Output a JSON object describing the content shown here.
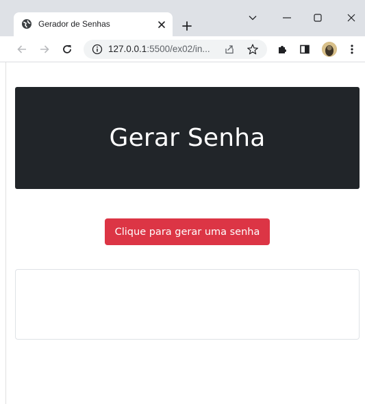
{
  "browser": {
    "tab": {
      "title": "Gerador de Senhas",
      "favicon": "globe-icon"
    },
    "address_bar": {
      "url_host": "127.0.0.1",
      "url_rest": ":5500/ex02/in..."
    },
    "icons": [
      "back-arrow-icon",
      "forward-arrow-icon",
      "reload-icon",
      "info-icon",
      "share-icon",
      "star-icon",
      "extensions-icon",
      "side-panel-icon",
      "profile-avatar",
      "menu-icon",
      "tab-search-icon",
      "minimize-icon",
      "maximize-icon",
      "close-icon",
      "new-tab-icon"
    ]
  },
  "page": {
    "hero_title": "Gerar Senha",
    "generate_button_label": "Clique para gerar uma senha",
    "output_value": ""
  },
  "colors": {
    "hero_bg": "#212529",
    "button_bg": "#dc3545",
    "tabstrip_bg": "#dee1e6"
  }
}
